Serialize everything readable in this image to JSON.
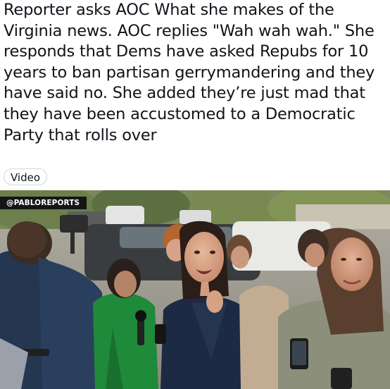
{
  "post": {
    "text": "Reporter asks AOC What she makes of the\nVirginia news. AOC replies \"Wah wah wah.\" She\nresponds that Dems have asked Repubs for 10\nyears to ban partisan gerrymandering and they\nhave said no. She added they’re just mad that\nthey have been accustomed to a Democratic\nParty that rolls over"
  },
  "media": {
    "badge_label": "Video",
    "watermark": "@PABLOREPORTS"
  },
  "colors": {
    "text": "#0f1419",
    "badge_border": "#cfd9de",
    "watermark_bg": "#151515"
  }
}
